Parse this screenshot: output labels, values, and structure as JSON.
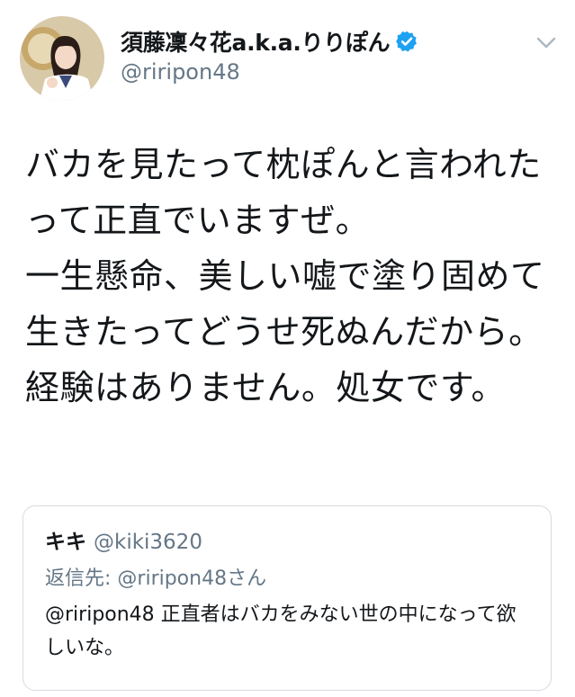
{
  "tweet": {
    "author": {
      "display_name": "須藤凜々花a.k.a.りりぽん",
      "handle": "@riripon48",
      "verified": true,
      "avatar_icon": "user-avatar"
    },
    "text": "バカを見たって枕ぽんと言われたって正直でいますぜ。\n一生懸命、美しい嘘で塗り固めて生きたってどうせ死ぬんだから。\n経験はありません。処女です。",
    "menu_icon": "chevron-down-icon"
  },
  "quote": {
    "name": "キキ",
    "handle": "@kiki3620",
    "reply_to": "返信先: @riripon48さん",
    "text": "@riripon48 正直者はバカをみない世の中になって欲しいな。"
  },
  "colors": {
    "verified": "#1da1f2",
    "secondary_text": "#657786",
    "primary_text": "#14171a",
    "border": "#d6dbe0"
  }
}
